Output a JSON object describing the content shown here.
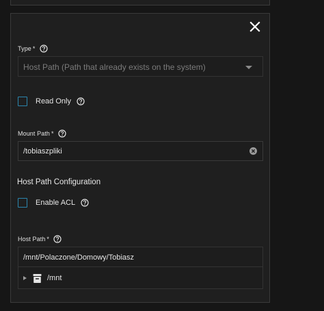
{
  "form": {
    "type_field": {
      "label": "Type",
      "required_mark": "*",
      "value": "Host Path (Path that already exists on the system)"
    },
    "read_only": {
      "label": "Read Only",
      "checked": false
    },
    "mount_path": {
      "label": "Mount Path",
      "required_mark": "*",
      "value": "/tobiaszpliki"
    },
    "host_path_configuration": {
      "heading": "Host Path Configuration",
      "enable_acl": {
        "label": "Enable ACL",
        "checked": false
      }
    },
    "host_path": {
      "label": "Host Path",
      "required_mark": "*",
      "value": "/mnt/Polaczone/Domowy/Tobiasz",
      "tree": [
        {
          "name": "/mnt",
          "expanded": false,
          "icon": "dataset-icon"
        }
      ]
    }
  },
  "icons": {
    "close": "close-icon",
    "help": "help-circle-icon",
    "clear": "clear-circle-icon",
    "caret": "dropdown-caret-icon",
    "expander": "tree-expand-arrow-icon"
  },
  "colors": {
    "background": "#161616",
    "card": "#1f1f1f",
    "border": "#3a3a3a",
    "accent_checkbox": "#2b86ae",
    "text": "#e5e5e5",
    "muted_text": "#7b7b7b"
  }
}
